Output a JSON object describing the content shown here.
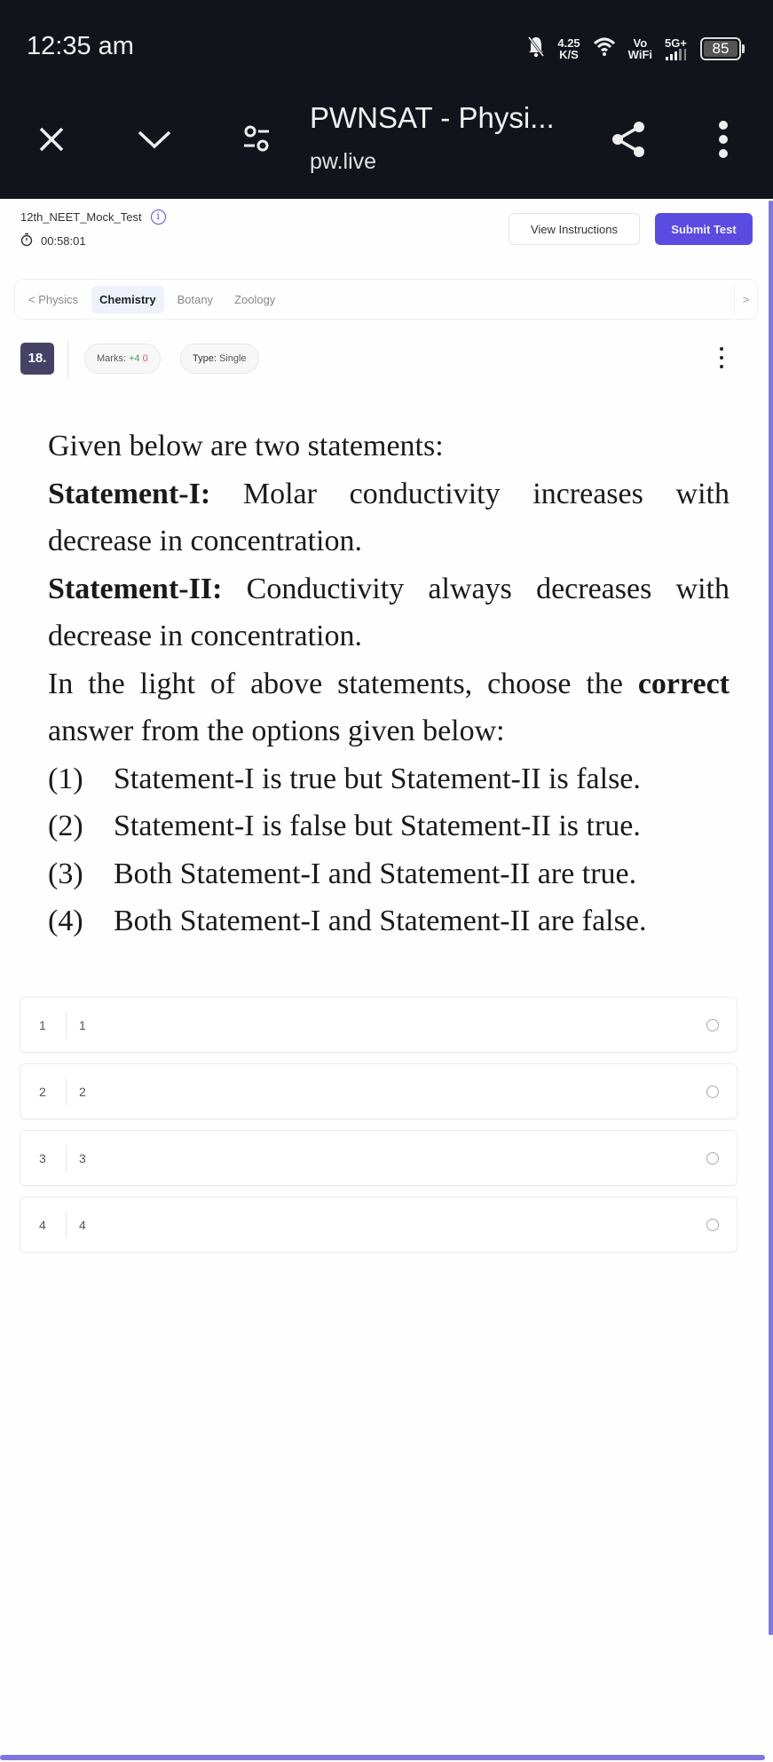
{
  "status_bar": {
    "time": "12:35 am",
    "net_speed_value": "4.25",
    "net_speed_unit": "K/S",
    "vowifi_top": "Vo",
    "vowifi_bottom": "WiFi",
    "network_type": "5G+",
    "battery": "85",
    "icons": [
      "bell-muted-icon",
      "wifi-icon",
      "signal-icon",
      "battery-icon"
    ]
  },
  "browser": {
    "title": "PWNSAT - Physi...",
    "url": "pw.live",
    "icons": [
      "close-icon",
      "chevron-down-icon",
      "site-settings-icon",
      "share-icon",
      "more-vert-icon"
    ]
  },
  "test": {
    "name": "12th_NEET_Mock_Test",
    "timer": "00:58:01",
    "view_instructions_label": "View Instructions",
    "submit_label": "Submit Test",
    "accent_color": "#5b4be0"
  },
  "subjects": {
    "prev_label": "< Physics",
    "tabs": [
      {
        "label": "Chemistry",
        "active": true
      },
      {
        "label": "Botany",
        "active": false
      },
      {
        "label": "Zoology",
        "active": false
      }
    ],
    "next_label": ">"
  },
  "question_meta": {
    "number": "18.",
    "marks_label": "Marks:",
    "marks_positive": "+4",
    "marks_negative": "0",
    "type_label": "Type:",
    "type_value": "Single"
  },
  "question": {
    "intro": "Given below are two statements:",
    "statement1_label": "Statement-I:",
    "statement1_text": " Molar conductivity increases with decrease in concentration.",
    "statement2_label": "Statement-II:",
    "statement2_text": " Conductivity always decreases with decrease in concentration.",
    "prompt_before": "In the light of above statements, choose the ",
    "prompt_bold": "correct",
    "prompt_after": " answer from the options given below:",
    "options": [
      {
        "num": "(1)",
        "text": "Statement-I is true but Statement-II is false."
      },
      {
        "num": "(2)",
        "text": "Statement-I is false but Statement-II is true."
      },
      {
        "num": "(3)",
        "text": "Both Statement-I and Statement-II are true."
      },
      {
        "num": "(4)",
        "text": "Both Statement-I and Statement-II are false."
      }
    ]
  },
  "answers": [
    {
      "label": "1",
      "text": "1",
      "selected": false
    },
    {
      "label": "2",
      "text": "2",
      "selected": false
    },
    {
      "label": "3",
      "text": "3",
      "selected": false
    },
    {
      "label": "4",
      "text": "4",
      "selected": false
    }
  ]
}
